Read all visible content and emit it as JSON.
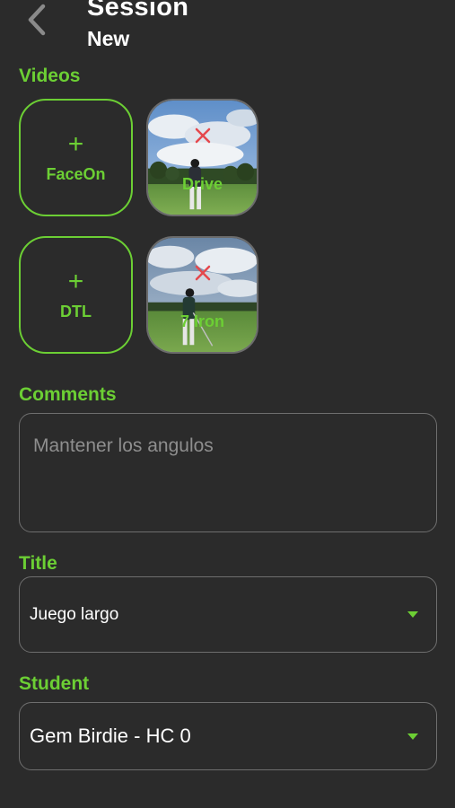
{
  "header": {
    "title": "Session",
    "subtitle": "New"
  },
  "videos": {
    "label": "Videos",
    "rows": [
      {
        "add_label": "FaceOn",
        "add_symbol": "+",
        "thumb_label": "Drive"
      },
      {
        "add_label": "DTL",
        "add_symbol": "+",
        "thumb_label": "7 Iron"
      }
    ]
  },
  "comments": {
    "label": "Comments",
    "placeholder": "Mantener los angulos"
  },
  "title_field": {
    "label": "Title",
    "value": "Juego largo"
  },
  "student_field": {
    "label": "Student",
    "value": "Gem Birdie - HC 0"
  },
  "colors": {
    "accent": "#6ccf34",
    "background": "#2b2b2b",
    "remove": "#e5484d"
  },
  "icons": [
    "chevron-left-icon",
    "plus-icon",
    "close-icon",
    "caret-down-icon"
  ]
}
